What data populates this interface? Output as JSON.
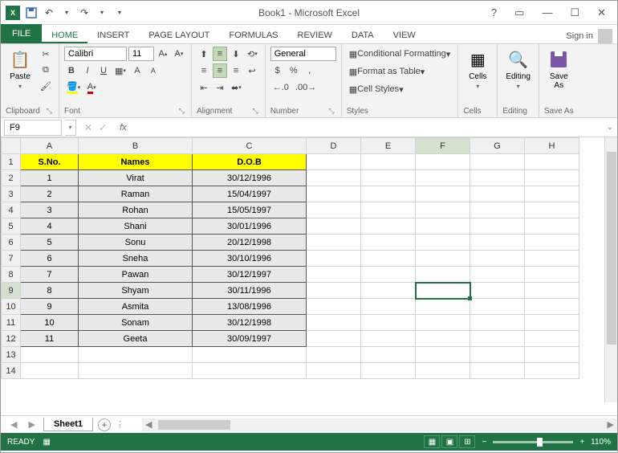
{
  "title": "Book1 - Microsoft Excel",
  "help_icon": "?",
  "signin": "Sign in",
  "tabs": {
    "file": "FILE",
    "list": [
      "HOME",
      "INSERT",
      "PAGE LAYOUT",
      "FORMULAS",
      "REVIEW",
      "DATA",
      "VIEW"
    ],
    "active": "HOME"
  },
  "ribbon": {
    "clipboard": {
      "label": "Clipboard",
      "paste": "Paste"
    },
    "font": {
      "label": "Font",
      "name": "Calibri",
      "size": "11",
      "bold": "B",
      "italic": "I",
      "underline": "U"
    },
    "alignment": {
      "label": "Alignment"
    },
    "number": {
      "label": "Number",
      "format": "General",
      "currency": "$",
      "percent": "%",
      "comma": ",",
      "incDec": ".0",
      "decInc": ".00"
    },
    "styles": {
      "label": "Styles",
      "cond": "Conditional Formatting",
      "table": "Format as Table",
      "cell": "Cell Styles"
    },
    "cells": {
      "label": "Cells",
      "btn": "Cells"
    },
    "editing": {
      "label": "Editing",
      "btn": "Editing"
    },
    "save": {
      "label": "Save As",
      "btn": "Save\nAs"
    }
  },
  "namebox": "F9",
  "fx": "fx",
  "columns": [
    "A",
    "B",
    "C",
    "D",
    "E",
    "F",
    "G",
    "H"
  ],
  "headers": {
    "sno": "S.No.",
    "names": "Names",
    "dob": "D.O.B"
  },
  "rows": [
    {
      "sno": "1",
      "name": "Virat",
      "dob": "30/12/1996"
    },
    {
      "sno": "2",
      "name": "Raman",
      "dob": "15/04/1997"
    },
    {
      "sno": "3",
      "name": "Rohan",
      "dob": "15/05/1997"
    },
    {
      "sno": "4",
      "name": "Shani",
      "dob": "30/01/1996"
    },
    {
      "sno": "5",
      "name": "Sonu",
      "dob": "20/12/1998"
    },
    {
      "sno": "6",
      "name": "Sneha",
      "dob": "30/10/1996"
    },
    {
      "sno": "7",
      "name": "Pawan",
      "dob": "30/12/1997"
    },
    {
      "sno": "8",
      "name": "Shyam",
      "dob": "30/11/1996"
    },
    {
      "sno": "9",
      "name": "Asmita",
      "dob": "13/08/1996"
    },
    {
      "sno": "10",
      "name": "Sonam",
      "dob": "30/12/1998"
    },
    {
      "sno": "11",
      "name": "Geeta",
      "dob": "30/09/1997"
    }
  ],
  "sheet": "Sheet1",
  "selected_cell": "F9",
  "status": {
    "ready": "READY",
    "zoom": "110%"
  }
}
